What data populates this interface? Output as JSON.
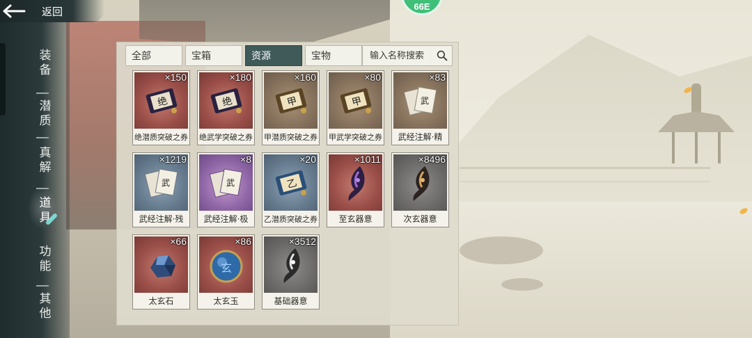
{
  "header": {
    "back_label": "返回",
    "badge_text": "66E"
  },
  "side_nav": {
    "items": [
      {
        "label": "装备",
        "active": false
      },
      {
        "label": "潜质",
        "active": false
      },
      {
        "label": "真解",
        "active": false
      },
      {
        "label": "道具",
        "active": true
      },
      {
        "label": "功能",
        "active": false
      },
      {
        "label": "其他",
        "active": false
      }
    ]
  },
  "tabs": [
    {
      "label": "全部",
      "active": false
    },
    {
      "label": "宝箱",
      "active": false
    },
    {
      "label": "资源",
      "active": true
    },
    {
      "label": "宝物",
      "active": false
    }
  ],
  "search": {
    "placeholder": "输入名称搜索",
    "value": ""
  },
  "items": [
    {
      "name": "绝潜质突破之券",
      "qty": "×150",
      "rarity": "red",
      "icon": "scroll-icon"
    },
    {
      "name": "绝武学突破之券",
      "qty": "×180",
      "rarity": "red",
      "icon": "scroll-icon"
    },
    {
      "name": "甲潜质突破之券",
      "qty": "×160",
      "rarity": "brown",
      "icon": "scroll-icon"
    },
    {
      "name": "甲武学突破之券",
      "qty": "×80",
      "rarity": "brown",
      "icon": "scroll-icon"
    },
    {
      "name": "武经注解·精",
      "qty": "×83",
      "rarity": "brown",
      "icon": "paper-icon"
    },
    {
      "name": "武经注解·残",
      "qty": "×1219",
      "rarity": "blue",
      "icon": "paper-icon"
    },
    {
      "name": "武经注解·极",
      "qty": "×8",
      "rarity": "purple",
      "icon": "paper-icon"
    },
    {
      "name": "乙潜质突破之券",
      "qty": "×20",
      "rarity": "blue",
      "icon": "scroll-icon"
    },
    {
      "name": "至玄器意",
      "qty": "×1011",
      "rarity": "red",
      "icon": "spirit-icon"
    },
    {
      "name": "次玄器意",
      "qty": "×8496",
      "rarity": "gray",
      "icon": "spirit-icon"
    },
    {
      "name": "太玄石",
      "qty": "×66",
      "rarity": "red",
      "icon": "crystal-icon"
    },
    {
      "name": "太玄玉",
      "qty": "×86",
      "rarity": "red",
      "icon": "jade-orb-icon"
    },
    {
      "name": "基础器意",
      "qty": "×3512",
      "rarity": "gray",
      "icon": "spirit-icon"
    }
  ],
  "colors": {
    "active_tab": "#3f5a59",
    "rarity_red": "#9b4f49",
    "rarity_brown": "#84705b",
    "rarity_blue": "#65798c",
    "rarity_purple": "#8d64a4",
    "rarity_gray": "#6a6967"
  }
}
